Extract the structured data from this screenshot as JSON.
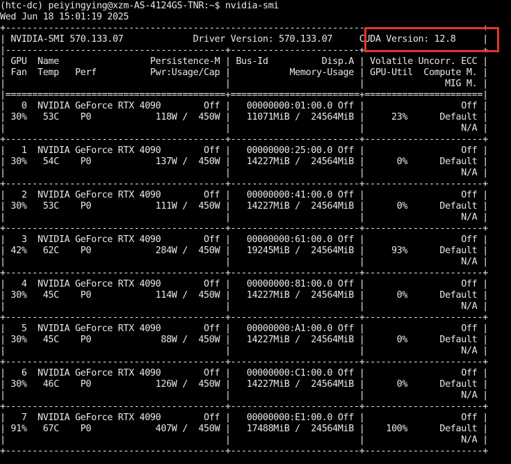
{
  "terminal": {
    "lines": [
      "(htc-dc) peiyingying@xzm-AS-4124GS-TNR:~$ nvidia-smi",
      "Wed Jun 18 15:01:19 2025",
      "+-----------------------------------------------------------------------------------------+",
      "| NVIDIA-SMI 570.133.07             Driver Version: 570.133.07     CUDA Version: 12.8     |",
      "|-----------------------------------------+------------------------+----------------------+",
      "| GPU  Name                 Persistence-M | Bus-Id          Disp.A | Volatile Uncorr. ECC |",
      "| Fan  Temp   Perf          Pwr:Usage/Cap |           Memory-Usage | GPU-Util  Compute M. |",
      "|                                         |                        |               MIG M. |",
      "|=========================================+========================+======================|",
      "|   0  NVIDIA GeForce RTX 4090        Off |   00000000:01:00.0 Off |                  Off |",
      "| 30%   53C    P0            118W /  450W |   11071MiB /  24564MiB |     23%      Default |",
      "|                                         |                        |                  N/A |",
      "+-----------------------------------------+------------------------+----------------------+",
      "|   1  NVIDIA GeForce RTX 4090        Off |   00000000:25:00.0 Off |                  Off |",
      "| 30%   54C    P0            137W /  450W |   14227MiB /  24564MiB |      0%      Default |",
      "|                                         |                        |                  N/A |",
      "+-----------------------------------------+------------------------+----------------------+",
      "|   2  NVIDIA GeForce RTX 4090        Off |   00000000:41:00.0 Off |                  Off |",
      "| 30%   53C    P0            111W /  450W |   14227MiB /  24564MiB |      0%      Default |",
      "|                                         |                        |                  N/A |",
      "+-----------------------------------------+------------------------+----------------------+",
      "|   3  NVIDIA GeForce RTX 4090        Off |   00000000:61:00.0 Off |                  Off |",
      "| 42%   62C    P0            284W /  450W |   19245MiB /  24564MiB |     93%      Default |",
      "|                                         |                        |                  N/A |",
      "+-----------------------------------------+------------------------+----------------------+",
      "|   4  NVIDIA GeForce RTX 4090        Off |   00000000:81:00.0 Off |                  Off |",
      "| 30%   45C    P0            114W /  450W |   14227MiB /  24564MiB |      0%      Default |",
      "|                                         |                        |                  N/A |",
      "+-----------------------------------------+------------------------+----------------------+",
      "|   5  NVIDIA GeForce RTX 4090        Off |   00000000:A1:00.0 Off |                  Off |",
      "| 30%   45C    P0             88W /  450W |   14227MiB /  24564MiB |      0%      Default |",
      "|                                         |                        |                  N/A |",
      "+-----------------------------------------+------------------------+----------------------+",
      "|   6  NVIDIA GeForce RTX 4090        Off |   00000000:C1:00.0 Off |                  Off |",
      "| 30%   46C    P0            126W /  450W |   14227MiB /  24564MiB |      0%      Default |",
      "|                                         |                        |                  N/A |",
      "+-----------------------------------------+------------------------+----------------------+",
      "|   7  NVIDIA GeForce RTX 4090        Off |   00000000:E1:00.0 Off |                  Off |",
      "| 91%   67C    P0            407W /  450W |   17488MiB /  24564MiB |    100%      Default |",
      "|                                         |                        |                  N/A |",
      "+-----------------------------------------+------------------------+----------------------+"
    ]
  },
  "colors": {
    "background": "#000000",
    "text": "#e8e8e8",
    "highlight_box": "#e53527"
  }
}
